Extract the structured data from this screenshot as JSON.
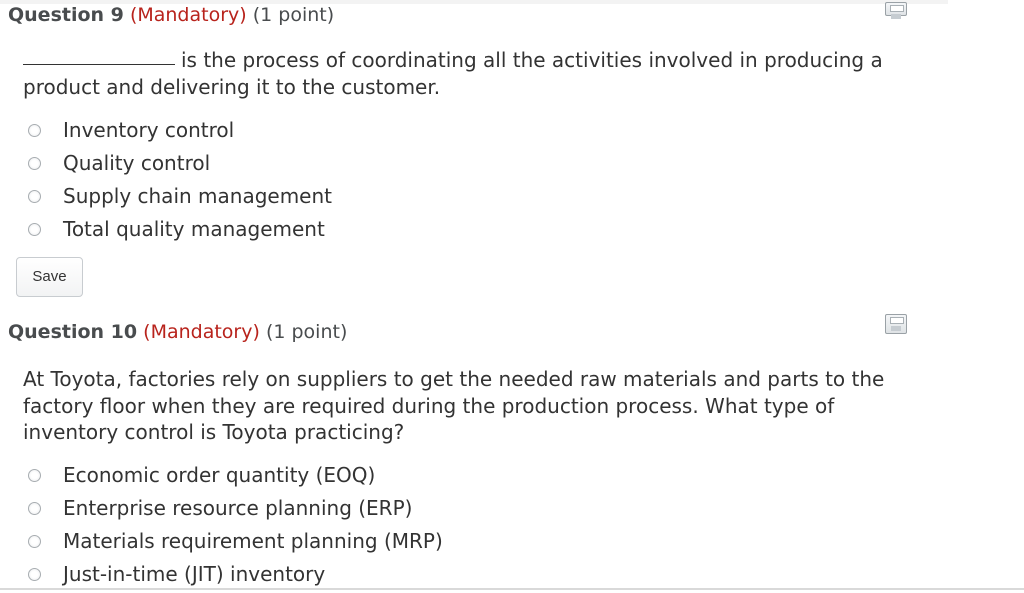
{
  "q9": {
    "label": "Question 9",
    "mandatory": "(Mandatory)",
    "points": "(1 point)",
    "stem": "is the process of coordinating all the activities involved in producing a product and delivering it to the customer.",
    "options": [
      "Inventory control",
      "Quality control",
      "Supply chain management",
      "Total quality management"
    ],
    "save_label": "Save"
  },
  "q10": {
    "label": "Question 10",
    "mandatory": "(Mandatory)",
    "points": "(1 point)",
    "stem": "At Toyota, factories rely on suppliers to get the needed raw materials and parts to the factory floor when they are required during the production process. What type of inventory control is Toyota practicing?",
    "options": [
      "Economic order quantity (EOQ)",
      "Enterprise resource planning (ERP)",
      "Materials requirement planning (MRP)",
      "Just-in-time (JIT) inventory"
    ]
  },
  "colors": {
    "mandatory": "#b8231c",
    "heading": "#494c4e",
    "text": "#333333"
  },
  "icons": {
    "save_question": "floppy-disk-icon",
    "radio": "radio-button"
  }
}
